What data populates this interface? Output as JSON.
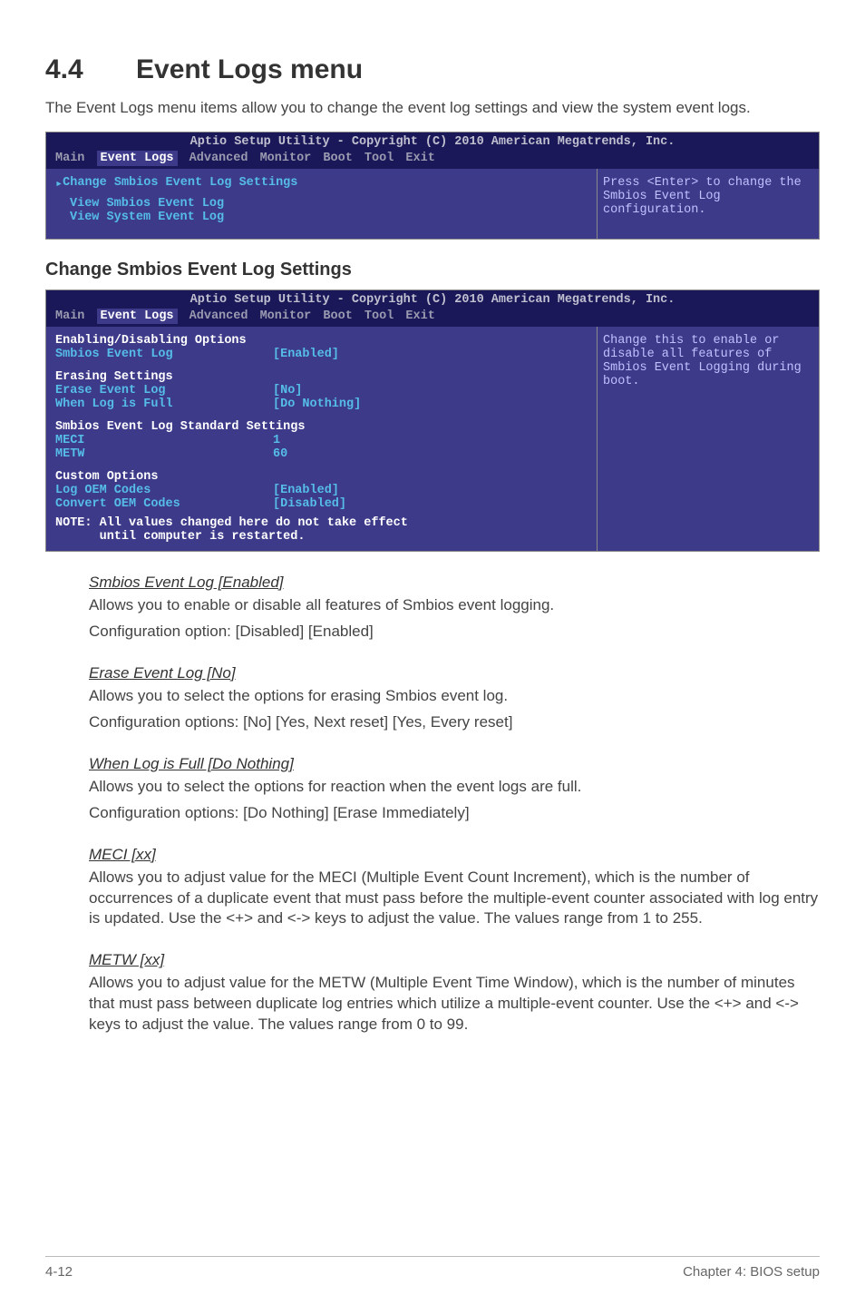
{
  "heading": {
    "num": "4.4",
    "title": "Event Logs menu"
  },
  "intro": "The Event Logs menu items allow you to change the event log settings and view the system event logs.",
  "bios1": {
    "title": "Aptio Setup Utility - Copyright (C) 2010 American Megatrends, Inc.",
    "tabs": [
      "Main",
      "Event Logs",
      "Advanced",
      "Monitor",
      "Boot",
      "Tool",
      "Exit"
    ],
    "selected_tab": "Event Logs",
    "left": {
      "arrow_item": "Change Smbios Event Log Settings",
      "lines": [
        "View Smbios Event Log",
        "View System Event Log"
      ]
    },
    "help": "Press <Enter> to change the Smbios Event Log configuration."
  },
  "subheading": "Change Smbios Event Log Settings",
  "bios2": {
    "title": "Aptio Setup Utility - Copyright (C) 2010 American Megatrends, Inc.",
    "tabs": [
      "Main",
      "Event Logs",
      "Advanced",
      "Monitor",
      "Boot",
      "Tool",
      "Exit"
    ],
    "selected_tab": "Event Logs",
    "g1_hdr": "Enabling/Disabling Options",
    "g1": [
      {
        "label": "Smbios Event Log",
        "value": "[Enabled]"
      }
    ],
    "g2_hdr": "Erasing Settings",
    "g2": [
      {
        "label": "Erase Event Log",
        "value": "[No]"
      },
      {
        "label": "When Log is Full",
        "value": "[Do Nothing]"
      }
    ],
    "g3_hdr": "Smbios Event Log Standard Settings",
    "g3": [
      {
        "label": "MECI",
        "value": "1"
      },
      {
        "label": "METW",
        "value": "60"
      }
    ],
    "g4_hdr": "Custom Options",
    "g4": [
      {
        "label": "Log OEM Codes",
        "value": "[Enabled]"
      },
      {
        "label": "Convert OEM Codes",
        "value": "[Disabled]"
      }
    ],
    "note1": "NOTE: All values changed here do not take effect",
    "note2": "      until computer is restarted.",
    "help": "Change this to enable or disable all features of Smbios Event Logging during boot."
  },
  "sections": [
    {
      "h": "Smbios Event Log [Enabled]",
      "p": [
        "Allows you to enable or disable all features of Smbios event logging.",
        "Configuration option: [Disabled] [Enabled]"
      ]
    },
    {
      "h": "Erase Event Log [No]",
      "p": [
        "Allows you to select the options for erasing Smbios event log.",
        "Configuration options: [No] [Yes, Next reset] [Yes, Every reset]"
      ]
    },
    {
      "h": "When Log is Full [Do Nothing]",
      "p": [
        "Allows you to select the options for reaction when the event logs are full.",
        "Configuration options: [Do Nothing] [Erase Immediately]"
      ]
    },
    {
      "h": "MECI [xx]",
      "p": [
        "Allows you to adjust value for the MECI (Multiple Event Count Increment), which is the number of occurrences of a duplicate event that must pass before the multiple-event counter associated with log entry is updated. Use the <+> and <-> keys to adjust the value. The values range from 1 to 255."
      ]
    },
    {
      "h": "METW [xx]",
      "p": [
        "Allows you to adjust value for the METW (Multiple Event Time Window), which is the number of minutes that must pass between duplicate log entries which utilize a multiple-event counter. Use the <+> and <-> keys to adjust the value. The values range from 0 to 99."
      ]
    }
  ],
  "footer": {
    "page": "4-12",
    "chapter": "Chapter 4: BIOS setup"
  }
}
